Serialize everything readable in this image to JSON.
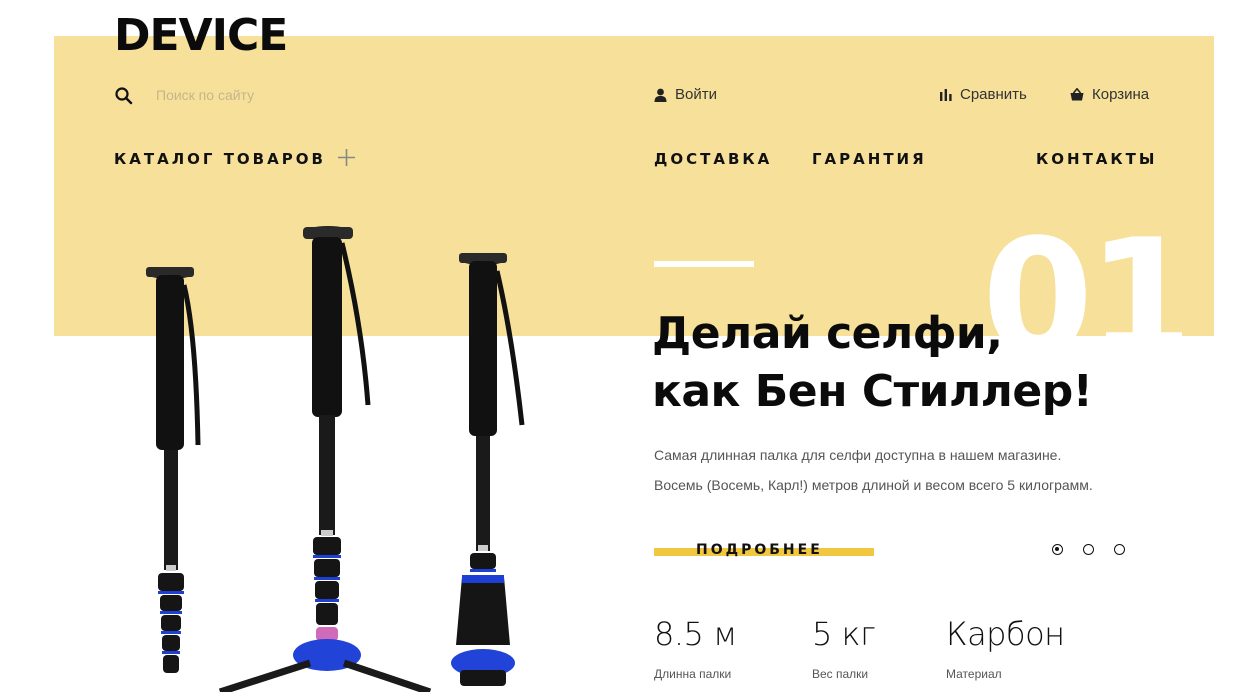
{
  "header": {
    "logo": "DEVICE",
    "search": {
      "placeholder": "Поиск по сайту",
      "icon": "search-icon"
    },
    "login": {
      "label": "Войти",
      "icon": "user-icon"
    },
    "compare": {
      "label": "Сравнить",
      "icon": "bar-chart-icon"
    },
    "cart": {
      "label": "Корзина",
      "icon": "basket-icon"
    }
  },
  "nav": {
    "catalog": "КАТАЛОГ ТОВАРОВ",
    "catalog_icon": "plus-icon",
    "delivery": "ДОСТАВКА",
    "warranty": "ГАРАНТИЯ",
    "contacts": "КОНТАКТЫ"
  },
  "slide": {
    "number": "01",
    "title_line1": "Делай селфи,",
    "title_line2": "как Бен Стиллер!",
    "desc_line1": "Самая длинная палка для селфи доступна в нашем магазине.",
    "desc_line2": "Восемь (Восемь, Карл!) метров длиной и весом всего 5 килограмм.",
    "more_button": "ПОДРОБНЕЕ",
    "pager": {
      "count": 3,
      "active": 1
    }
  },
  "specs": [
    {
      "value": "8.5 м",
      "label": "Длинна палки"
    },
    {
      "value": "5 кг",
      "label": "Вес палки"
    },
    {
      "value": "Карбон",
      "label": "Материал"
    }
  ],
  "colors": {
    "band": "#f6e09a",
    "accent": "#f0c73f",
    "text": "#111111"
  }
}
